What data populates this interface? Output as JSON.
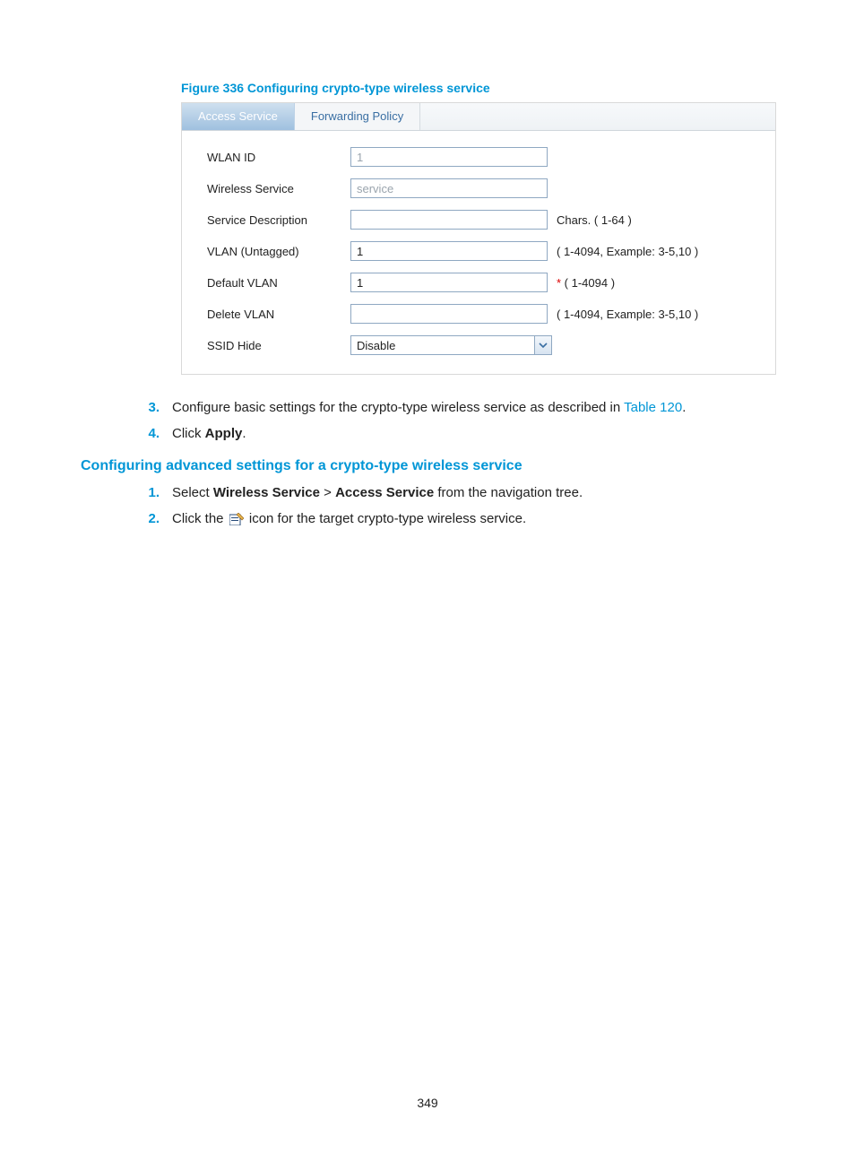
{
  "figure_caption": "Figure 336 Configuring crypto-type wireless service",
  "tabs": {
    "access_service": "Access Service",
    "forwarding_policy": "Forwarding Policy"
  },
  "form": {
    "wlan_id": {
      "label": "WLAN ID",
      "value": "1"
    },
    "wireless_service": {
      "label": "Wireless Service",
      "value": "service"
    },
    "service_description": {
      "label": "Service Description",
      "value": "",
      "hint": "Chars. ( 1-64 )"
    },
    "vlan_untagged": {
      "label": "VLAN (Untagged)",
      "value": "1",
      "hint": "( 1-4094, Example: 3-5,10 )"
    },
    "default_vlan": {
      "label": "Default VLAN",
      "value": "1",
      "hint_star": "*",
      "hint": " ( 1-4094 )"
    },
    "delete_vlan": {
      "label": "Delete VLAN",
      "value": "",
      "hint": "( 1-4094, Example: 3-5,10 )"
    },
    "ssid_hide": {
      "label": "SSID Hide",
      "value": "Disable"
    }
  },
  "steps1": {
    "s3": {
      "num": "3.",
      "pre": "Configure basic settings for the crypto-type wireless service as described in ",
      "link": "Table 120",
      "post": "."
    },
    "s4": {
      "num": "4.",
      "pre": "Click ",
      "bold": "Apply",
      "post": "."
    }
  },
  "section_heading": "Configuring advanced settings for a crypto-type wireless service",
  "steps2": {
    "s1": {
      "num": "1.",
      "a": "Select ",
      "b1": "Wireless Service",
      "gt": " > ",
      "b2": "Access Service",
      "c": " from the navigation tree."
    },
    "s2": {
      "num": "2.",
      "a": "Click the ",
      "b": " icon for the target crypto-type wireless service."
    }
  },
  "page_number": "349"
}
